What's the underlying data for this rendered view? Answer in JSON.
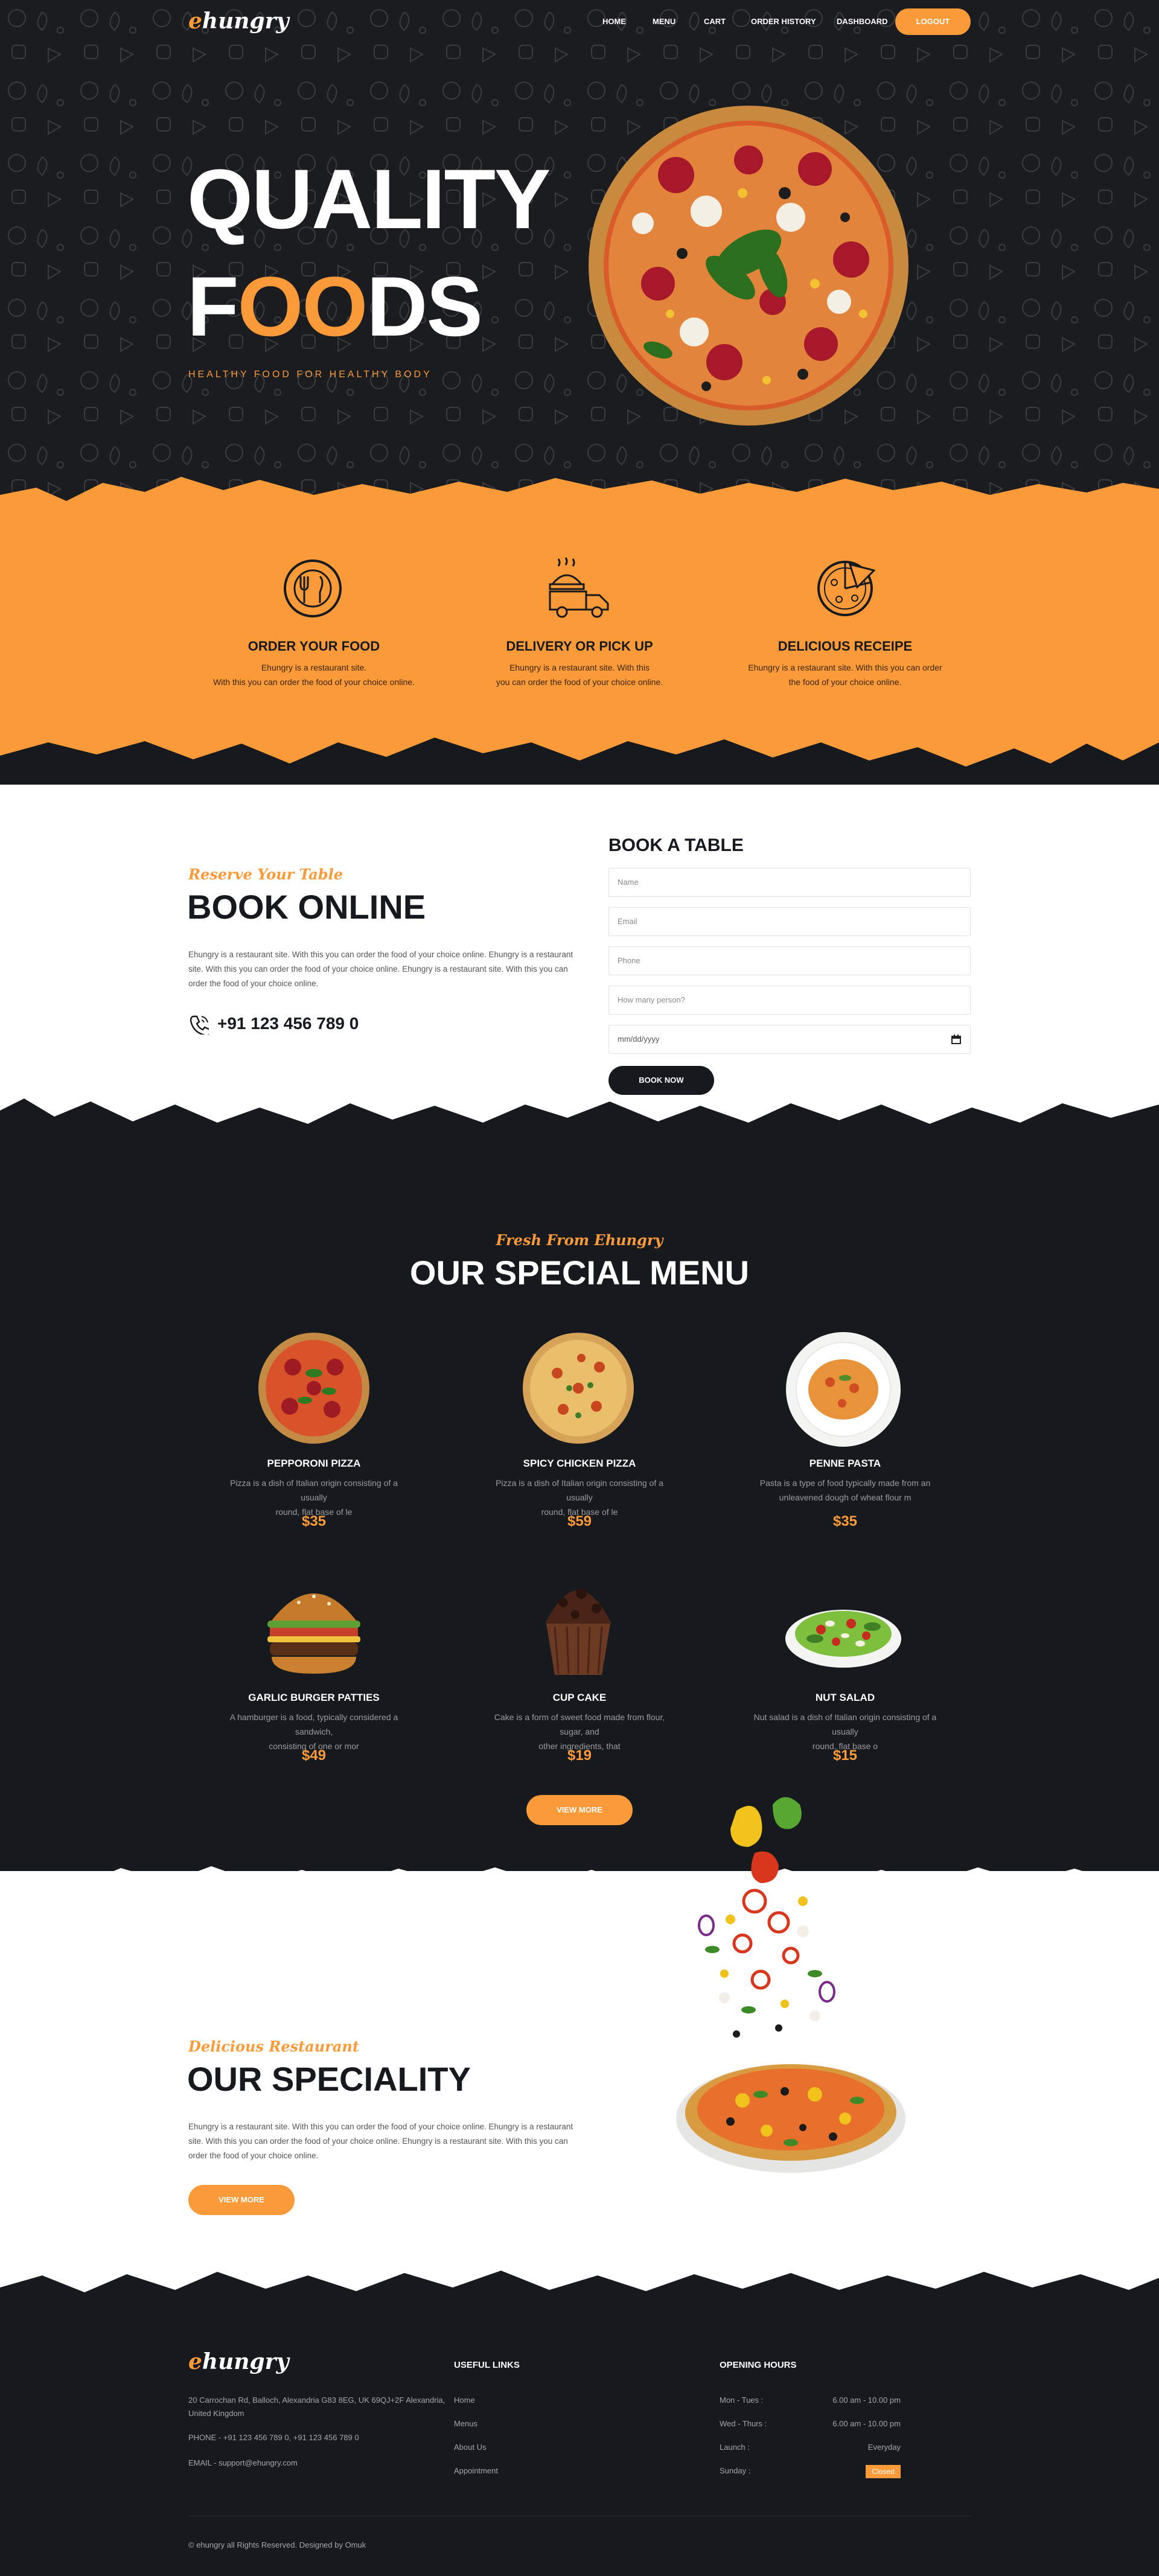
{
  "brand": {
    "logo_first": "e",
    "logo_rest": "hungry"
  },
  "nav": {
    "items": [
      "HOME",
      "MENU",
      "CART",
      "ORDER HISTORY",
      "DASHBOARD"
    ],
    "logout": "LOGOUT"
  },
  "hero": {
    "line1": "QUALITY",
    "line2_a": "F",
    "line2_b": "OO",
    "line2_c": "DS",
    "tagline": "HEALTHY FOOD FOR HEALTHY BODY"
  },
  "features": [
    {
      "icon": "cutlery-plate-icon",
      "title": "ORDER YOUR FOOD",
      "line1": "Ehungry is a restaurant site.",
      "line2": "With this you can order the food of your choice online."
    },
    {
      "icon": "delivery-truck-icon",
      "title": "DELIVERY OR PICK UP",
      "line1": "Ehungry is a restaurant site. With this",
      "line2": "you can order the food of your choice online."
    },
    {
      "icon": "pizza-icon",
      "title": "DELICIOUS RECEIPE",
      "line1": "Ehungry is a restaurant site. With this you can order",
      "line2": "the food of your choice online."
    }
  ],
  "booking": {
    "kicker": "Reserve Your Table",
    "title": "BOOK ONLINE",
    "para": [
      "Ehungry is a restaurant site. With this you can order the food of your choice online. Ehungry is a restaurant",
      "site. With this you can order the food of your choice online. Ehungry is a restaurant site. With this you can",
      "order the food of your choice online."
    ],
    "phone": "+91 123 456 789 0",
    "form_title": "BOOK A TABLE",
    "fields": [
      "Name",
      "Email",
      "Phone",
      "How many person?"
    ],
    "date_placeholder": "mm/dd/yyyy",
    "submit": "BOOK NOW"
  },
  "menu": {
    "kicker": "Fresh From Ehungry",
    "title": "OUR SPECIAL MENU",
    "items": [
      {
        "name": "PEPPORONI PIZZA",
        "desc1": "Pizza is a dish of Italian origin consisting of a usually",
        "desc2": "round, flat base of le",
        "price": "$35"
      },
      {
        "name": "SPICY CHICKEN PIZZA",
        "desc1": "Pizza is a dish of Italian origin consisting of a usually",
        "desc2": "round, flat base of le",
        "price": "$59"
      },
      {
        "name": "PENNE PASTA",
        "desc1": "Pasta is a type of food typically made from an",
        "desc2": "unleavened dough of wheat flour m",
        "price": "$35"
      },
      {
        "name": "GARLIC BURGER PATTIES",
        "desc1": "A hamburger is a food, typically considered a sandwich,",
        "desc2": "consisting of one or mor",
        "price": "$49"
      },
      {
        "name": "CUP CAKE",
        "desc1": "Cake is a form of sweet food made from flour, sugar, and",
        "desc2": "other ingredients, that",
        "price": "$19"
      },
      {
        "name": "NUT SALAD",
        "desc1": "Nut salad is a dish of Italian origin consisting of a usually",
        "desc2": "round, flat base o",
        "price": "$15"
      }
    ],
    "view_more": "VIEW MORE"
  },
  "speciality": {
    "kicker": "Delicious Restaurant",
    "title": "OUR SPECIALITY",
    "para": [
      "Ehungry is a restaurant site. With this you can order the food of your choice online. Ehungry is a restaurant",
      "site. With this you can order the food of your choice online. Ehungry is a restaurant site. With this you can",
      "order the food of your choice online."
    ],
    "button": "VIEW MORE"
  },
  "footer": {
    "address1": "20 Carrochan Rd, Balloch, Alexandria G83 8EG, UK 69QJ+2F Alexandria,",
    "address2": "United Kingdom",
    "phone": "PHONE - +91 123 456 789 0, +91 123 456 789 0",
    "email": "EMAIL - support@ehungry.com",
    "links_title": "USEFUL LINKS",
    "links": [
      "Home",
      "Menus",
      "About Us",
      "Appointment"
    ],
    "hours_title": "OPENING HOURS",
    "hours": [
      {
        "day": "Mon - Tues :",
        "time": "6.00 am - 10.00 pm"
      },
      {
        "day": "Wed - Thurs :",
        "time": "6.00 am - 10.00 pm"
      },
      {
        "day": "Launch :",
        "time": "Everyday"
      },
      {
        "day": "Sunday :",
        "time": "Closed"
      }
    ],
    "copyright": "© ehungry all Rights Reserved. Designed by Omuk"
  },
  "colors": {
    "accent": "#fb9a38",
    "dark": "#16191d",
    "white": "#ffffff"
  }
}
